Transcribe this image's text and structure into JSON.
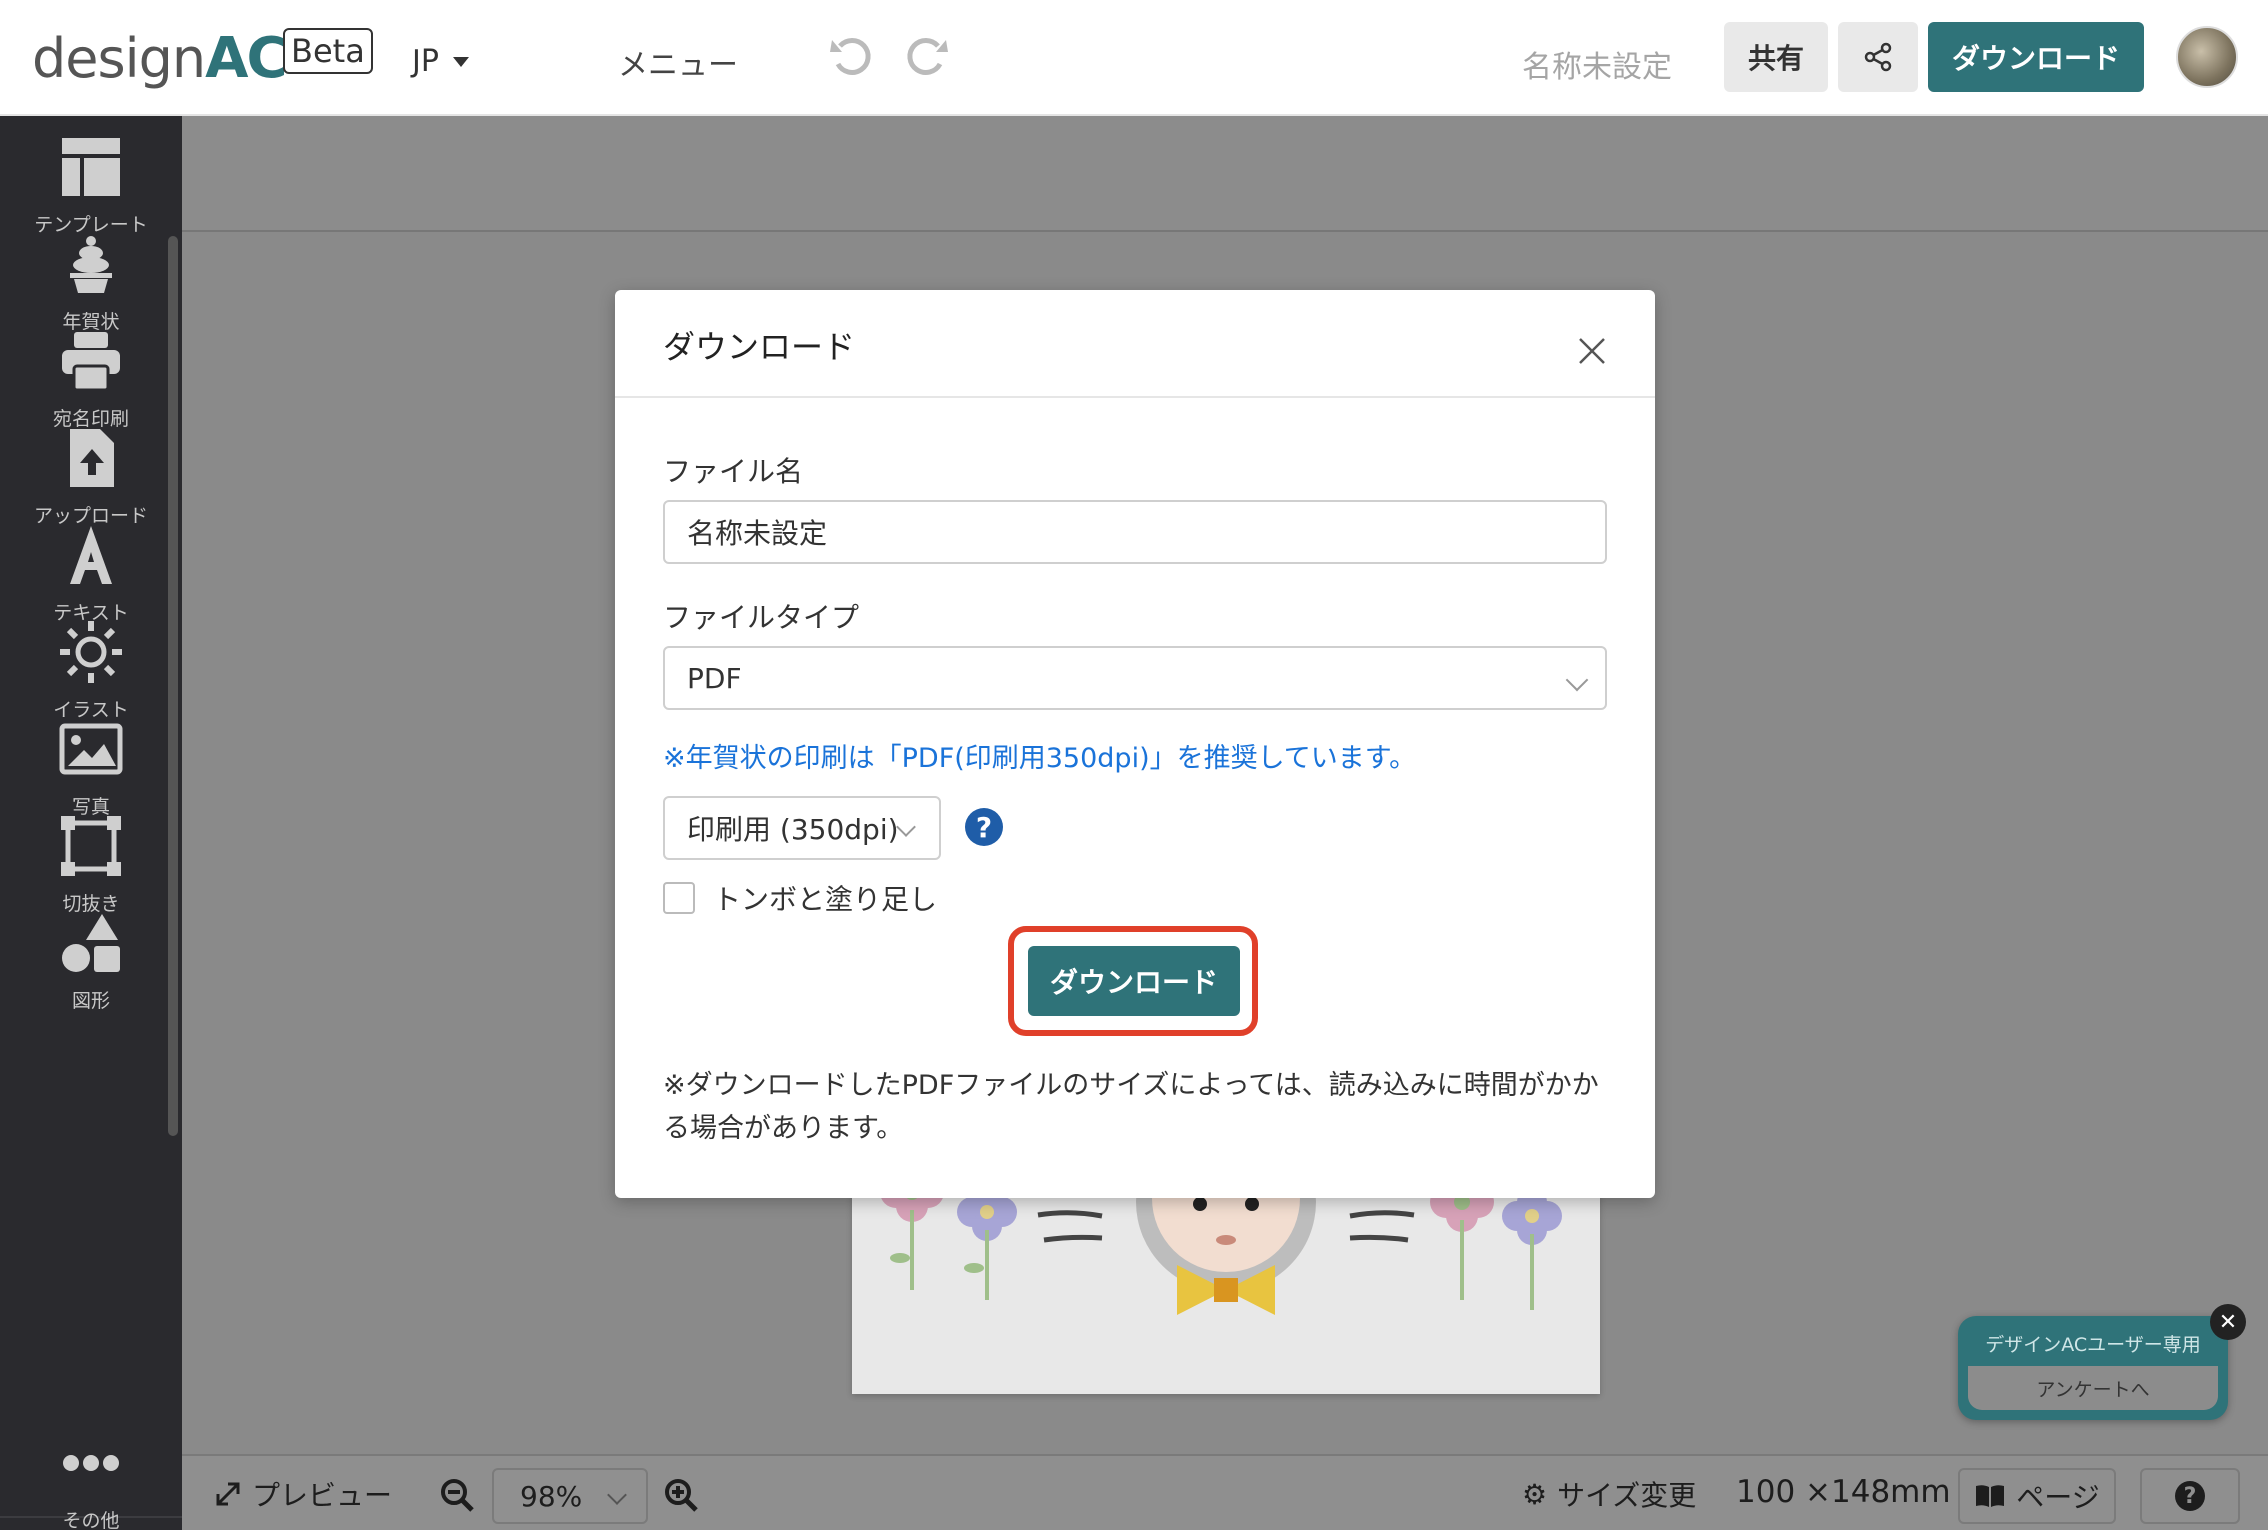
{
  "header": {
    "logo_text": "design",
    "logo_ac": "AC",
    "beta_label": "Beta",
    "language": "JP",
    "menu_label": "メニュー",
    "document_name": "名称未設定",
    "share_label": "共有",
    "download_label": "ダウンロード"
  },
  "sidebar": {
    "items": [
      {
        "label": "テンプレート",
        "icon": "template-icon"
      },
      {
        "label": "年賀状",
        "icon": "kagami-mochi-icon"
      },
      {
        "label": "宛名印刷",
        "icon": "printer-icon"
      },
      {
        "label": "アップロード",
        "icon": "upload-icon"
      },
      {
        "label": "テキスト",
        "icon": "text-icon"
      },
      {
        "label": "イラスト",
        "icon": "sun-icon"
      },
      {
        "label": "写真",
        "icon": "photo-icon"
      },
      {
        "label": "切抜き",
        "icon": "crop-icon"
      },
      {
        "label": "図形",
        "icon": "shapes-icon"
      },
      {
        "label": "その他",
        "icon": "more-icon"
      }
    ]
  },
  "modal": {
    "title": "ダウンロード",
    "file_name_label": "ファイル名",
    "file_name_value": "名称未設定",
    "file_type_label": "ファイルタイプ",
    "file_type_value": "PDF",
    "recommend_note": "※年賀状の印刷は「PDF(印刷用350dpi)」を推奨しています。",
    "resolution_value": "印刷用 (350dpi)",
    "help_glyph": "?",
    "crop_marks_label": "トンボと塗り足し",
    "crop_marks_checked": false,
    "download_button": "ダウンロード",
    "bottom_note": "※ダウンロードしたPDFファイルのサイズによっては、読み込みに時間がかかる場合があります。"
  },
  "bottombar": {
    "preview_label": "プレビュー",
    "zoom_value": "98%",
    "resize_label": "サイズ変更",
    "dimensions": "100 ×148mm",
    "page_label": "ページ",
    "help_glyph": "?"
  },
  "survey": {
    "title": "デザインACユーザー専用",
    "button": "アンケートへ",
    "close_glyph": "✕"
  },
  "colors": {
    "accent": "#2f7379",
    "link_blue": "#1a73d9",
    "highlight_red": "#e0402a",
    "sidebar_bg": "#2a2a2e"
  }
}
